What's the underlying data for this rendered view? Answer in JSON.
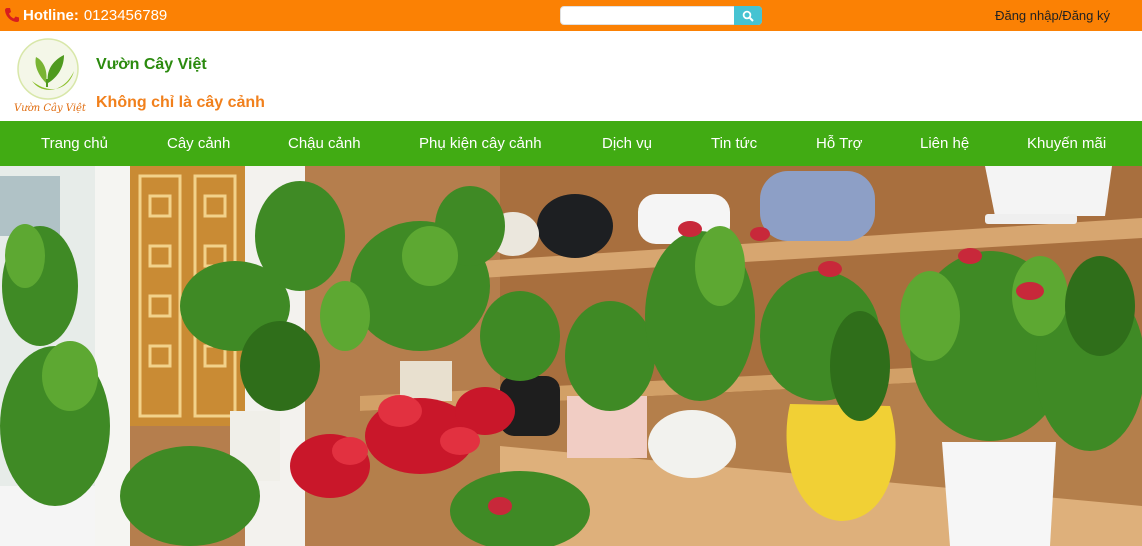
{
  "topbar": {
    "hotline_label": "Hotline:",
    "hotline_number": "0123456789",
    "search_placeholder": "",
    "search_value": "",
    "login_link": "Đăng nhập/Đăng ký",
    "bg_color": "#fb8104",
    "icons": {
      "phone": "phone-icon",
      "search": "search-icon"
    }
  },
  "brand": {
    "name": "Vườn Cây Việt",
    "tagline": "Không chỉ là cây cảnh",
    "logo_text": "Vườn Cây Việt"
  },
  "nav": {
    "bg_color": "#41ab13",
    "items": [
      {
        "label": "Trang chủ"
      },
      {
        "label": "Cây cảnh"
      },
      {
        "label": "Chậu cảnh"
      },
      {
        "label": "Phụ kiện cây cảnh"
      },
      {
        "label": "Dịch vụ"
      },
      {
        "label": "Tin tức"
      },
      {
        "label": "Hỗ Trợ"
      },
      {
        "label": "Liên hệ"
      },
      {
        "label": "Khuyến mãi"
      }
    ]
  },
  "banner": {
    "subject": "plant-shop-shelf-photo"
  }
}
